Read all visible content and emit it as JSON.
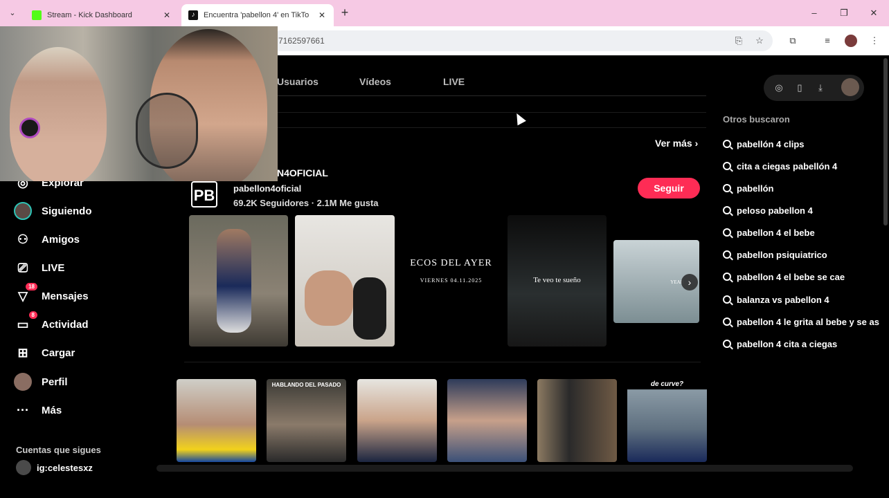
{
  "browser": {
    "tabs": [
      {
        "title": "Stream - Kick Dashboard",
        "favicon": "kick-icon",
        "active": false
      },
      {
        "title": "Encuentra 'pabellon 4' en TikTo",
        "favicon": "tiktok-icon",
        "active": true
      }
    ],
    "url": "7162597661",
    "colors": {
      "tab_strip": "#f6c9e4",
      "accent": "#fe2c55"
    }
  },
  "search_tabs": [
    "Usuarios",
    "Vídeos",
    "LIVE"
  ],
  "top_account": {
    "display_name": "N4OFICIAL",
    "handle": "pabellon4oficial",
    "stats": "69.2K Seguidores  ·  2.1M Me gusta",
    "follow_label": "Seguir",
    "see_more": "Ver más"
  },
  "account_videos": [
    {
      "title_text": ""
    },
    {
      "title_text": ""
    },
    {
      "title_text": "ECOS DEL AYER",
      "subtitle_text": "VIERNES 04.11.2025"
    },
    {
      "title_text": "Te veo te sueño"
    },
    {
      "title_text": "YEAH"
    }
  ],
  "video_grid": [
    {
      "overlay": ""
    },
    {
      "overlay": "HABLANDO DEL PASADO"
    },
    {
      "overlay": ""
    },
    {
      "overlay": ""
    },
    {
      "overlay": ""
    },
    {
      "overlay": "de curve?"
    }
  ],
  "sidebar": {
    "items": [
      {
        "label": "Explorar",
        "icon": "compass-icon"
      },
      {
        "label": "Siguiendo",
        "icon": "following-avatar-icon"
      },
      {
        "label": "Amigos",
        "icon": "friends-icon"
      },
      {
        "label": "LIVE",
        "icon": "live-tv-icon"
      },
      {
        "label": "Mensajes",
        "icon": "messages-icon",
        "badge": "18"
      },
      {
        "label": "Actividad",
        "icon": "activity-icon",
        "badge": "8"
      },
      {
        "label": "Cargar",
        "icon": "upload-icon"
      },
      {
        "label": "Perfil",
        "icon": "profile-avatar-icon"
      },
      {
        "label": "Más",
        "icon": "more-icon"
      }
    ],
    "following_header": "Cuentas que sigues",
    "following_accounts": [
      "ig:celestesxz"
    ]
  },
  "right_panel": {
    "header": "Otros buscaron",
    "suggestions": [
      "pabellón 4 clips",
      "cita a ciegas pabellón 4",
      "pabellón",
      "peloso pabellon 4",
      "pabellon 4 el bebe",
      "pabellon psiquiatrico",
      "pabellon 4 el bebe se cae",
      "balanza vs pabellon 4",
      "pabellon 4 le grita al bebe y se as",
      "pabellon 4 cita a ciegas"
    ]
  }
}
